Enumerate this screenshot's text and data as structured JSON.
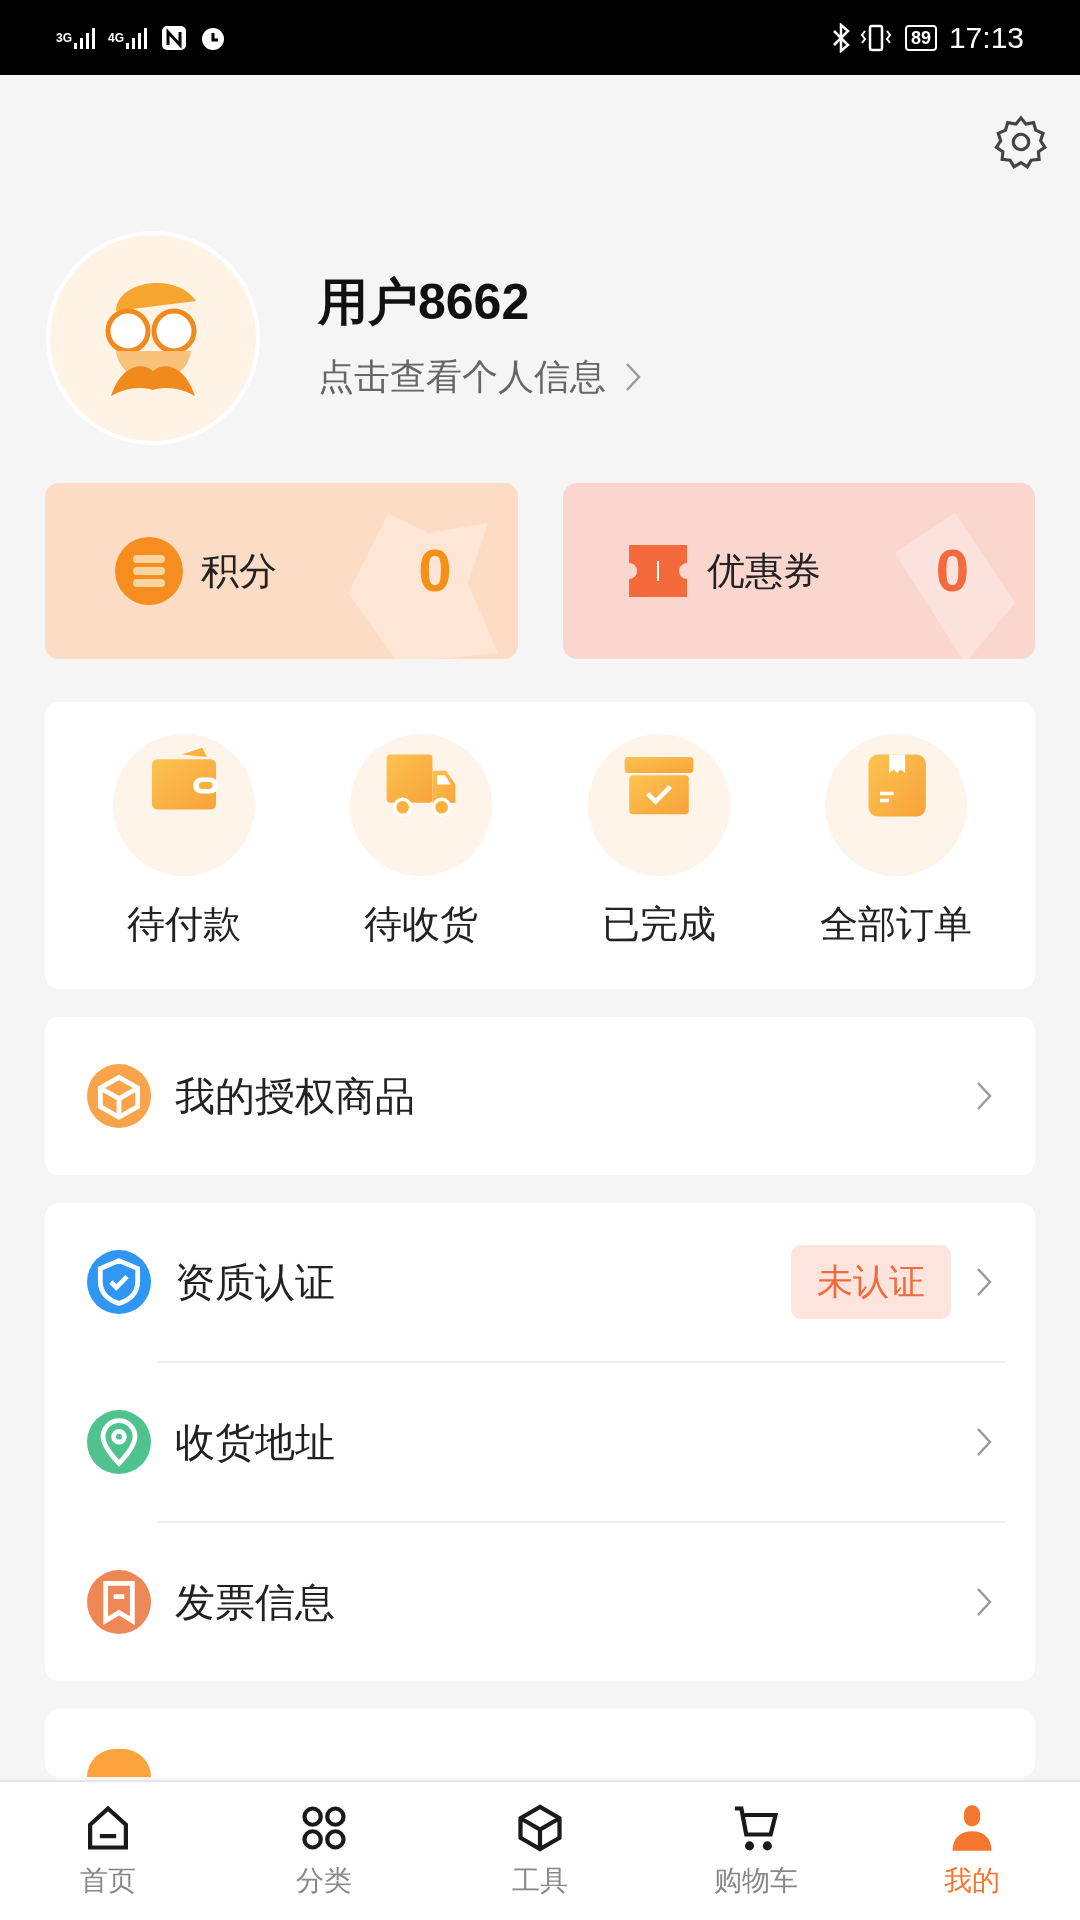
{
  "status_bar": {
    "network_1": "3G",
    "network_2": "4G",
    "battery": "89",
    "time": "17:13"
  },
  "profile": {
    "name": "用户8662",
    "subtitle": "点击查看个人信息"
  },
  "assets": [
    {
      "kind": "points",
      "label": "积分",
      "value": "0"
    },
    {
      "kind": "coupon",
      "label": "优惠券",
      "value": "0"
    }
  ],
  "orders": [
    {
      "kind": "wallet",
      "label": "待付款"
    },
    {
      "kind": "truck",
      "label": "待收货"
    },
    {
      "kind": "done",
      "label": "已完成"
    },
    {
      "kind": "all",
      "label": "全部订单"
    }
  ],
  "menu_groups": [
    {
      "items": [
        {
          "kind": "cube",
          "label": "我的授权商品",
          "color": "#f9a34b"
        }
      ]
    },
    {
      "items": [
        {
          "kind": "shield",
          "label": "资质认证",
          "color": "#2f96f3",
          "badge": "未认证"
        },
        {
          "kind": "pin",
          "label": "收货地址",
          "color": "#4fc28e"
        },
        {
          "kind": "invoice",
          "label": "发票信息",
          "color": "#ee8756"
        }
      ]
    },
    {
      "items": [
        {
          "color": "#fba33c"
        }
      ]
    }
  ],
  "tabs": [
    {
      "kind": "home",
      "label": "首页",
      "selected": false
    },
    {
      "kind": "category",
      "label": "分类",
      "selected": false
    },
    {
      "kind": "tools",
      "label": "工具",
      "selected": false
    },
    {
      "kind": "cart",
      "label": "购物车",
      "selected": false
    },
    {
      "kind": "me",
      "label": "我的",
      "selected": true
    }
  ]
}
